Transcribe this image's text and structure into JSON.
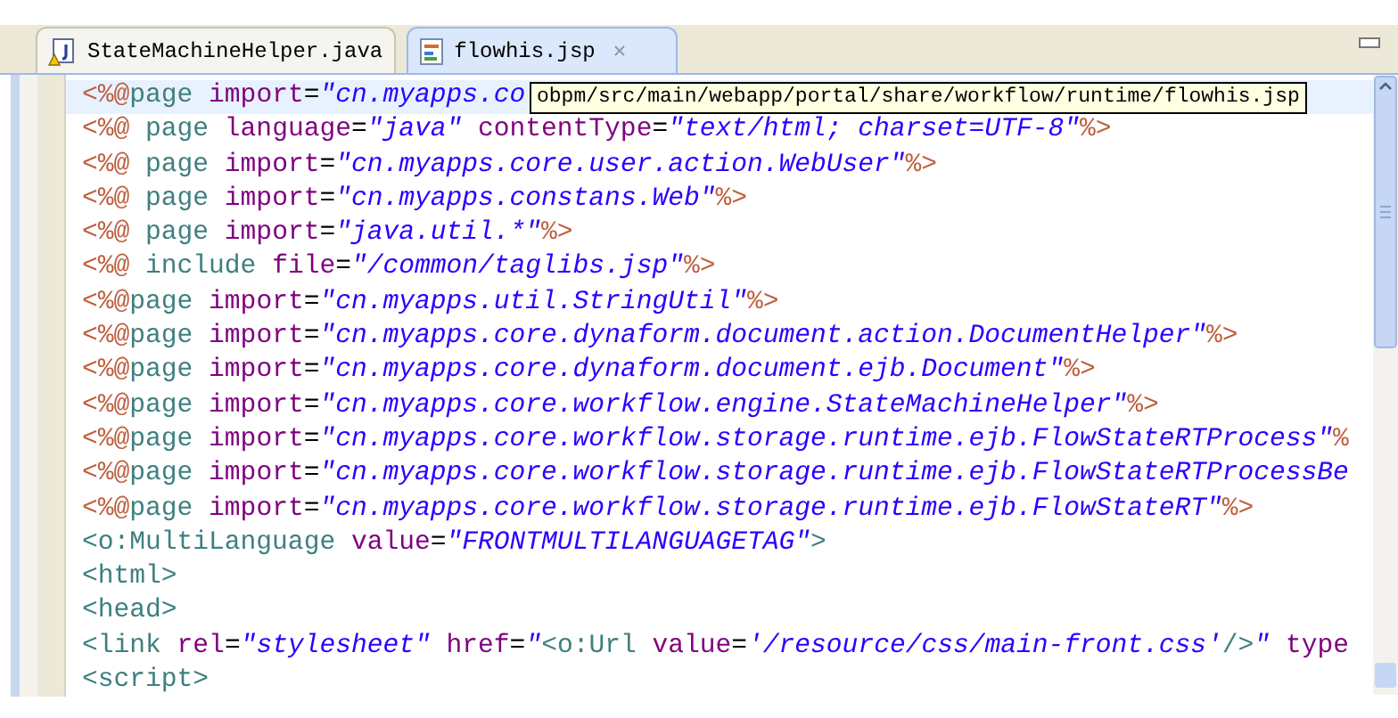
{
  "tabs": [
    {
      "label": "StateMachineHelper.java",
      "kind": "java",
      "selected": false
    },
    {
      "label": "flowhis.jsp",
      "kind": "jsp",
      "selected": true,
      "close": "✕"
    }
  ],
  "tooltip": "obpm/src/main/webapp/portal/share/workflow/runtime/flowhis.jsp",
  "editor": {
    "lines": [
      {
        "current": true,
        "tokens": [
          {
            "kind": "delim",
            "text": "<%@"
          },
          {
            "kind": "tag",
            "text": "page"
          },
          {
            "kind": "attr",
            "text": " import"
          },
          {
            "kind": "plain",
            "text": "="
          },
          {
            "kind": "string",
            "text": "\"cn.myapps.co"
          }
        ]
      },
      {
        "current": false,
        "tokens": [
          {
            "kind": "delim",
            "text": "<%@"
          },
          {
            "kind": "tag",
            "text": " page"
          },
          {
            "kind": "attr",
            "text": " language"
          },
          {
            "kind": "plain",
            "text": "="
          },
          {
            "kind": "string",
            "text": "\"java\""
          },
          {
            "kind": "attr",
            "text": " contentType"
          },
          {
            "kind": "plain",
            "text": "="
          },
          {
            "kind": "string",
            "text": "\"text/html; charset=UTF-8\""
          },
          {
            "kind": "delim",
            "text": "%>"
          }
        ]
      },
      {
        "current": false,
        "tokens": [
          {
            "kind": "delim",
            "text": "<%@"
          },
          {
            "kind": "tag",
            "text": " page"
          },
          {
            "kind": "attr",
            "text": " import"
          },
          {
            "kind": "plain",
            "text": "="
          },
          {
            "kind": "string",
            "text": "\"cn.myapps.core.user.action.WebUser\""
          },
          {
            "kind": "delim",
            "text": "%>"
          }
        ]
      },
      {
        "current": false,
        "tokens": [
          {
            "kind": "delim",
            "text": "<%@"
          },
          {
            "kind": "tag",
            "text": " page"
          },
          {
            "kind": "attr",
            "text": " import"
          },
          {
            "kind": "plain",
            "text": "="
          },
          {
            "kind": "string",
            "text": "\"cn.myapps.constans.Web\""
          },
          {
            "kind": "delim",
            "text": "%>"
          }
        ]
      },
      {
        "current": false,
        "tokens": [
          {
            "kind": "delim",
            "text": "<%@"
          },
          {
            "kind": "tag",
            "text": " page"
          },
          {
            "kind": "attr",
            "text": " import"
          },
          {
            "kind": "plain",
            "text": "="
          },
          {
            "kind": "string",
            "text": "\"java.util.*\""
          },
          {
            "kind": "delim",
            "text": "%>"
          }
        ]
      },
      {
        "current": false,
        "tokens": [
          {
            "kind": "delim",
            "text": "<%@"
          },
          {
            "kind": "tag",
            "text": " include"
          },
          {
            "kind": "attr",
            "text": " file"
          },
          {
            "kind": "plain",
            "text": "="
          },
          {
            "kind": "string",
            "text": "\"/common/taglibs.jsp\""
          },
          {
            "kind": "delim",
            "text": "%>"
          }
        ]
      },
      {
        "current": false,
        "tokens": [
          {
            "kind": "delim",
            "text": "<%@"
          },
          {
            "kind": "tag",
            "text": "page"
          },
          {
            "kind": "attr",
            "text": " import"
          },
          {
            "kind": "plain",
            "text": "="
          },
          {
            "kind": "string",
            "text": "\"cn.myapps.util.StringUtil\""
          },
          {
            "kind": "delim",
            "text": "%>"
          }
        ]
      },
      {
        "current": false,
        "tokens": [
          {
            "kind": "delim",
            "text": "<%@"
          },
          {
            "kind": "tag",
            "text": "page"
          },
          {
            "kind": "attr",
            "text": " import"
          },
          {
            "kind": "plain",
            "text": "="
          },
          {
            "kind": "string",
            "text": "\"cn.myapps.core.dynaform.document.action.DocumentHelper\""
          },
          {
            "kind": "delim",
            "text": "%>"
          }
        ]
      },
      {
        "current": false,
        "tokens": [
          {
            "kind": "delim",
            "text": "<%@"
          },
          {
            "kind": "tag",
            "text": "page"
          },
          {
            "kind": "attr",
            "text": " import"
          },
          {
            "kind": "plain",
            "text": "="
          },
          {
            "kind": "string",
            "text": "\"cn.myapps.core.dynaform.document.ejb.Document\""
          },
          {
            "kind": "delim",
            "text": "%>"
          }
        ]
      },
      {
        "current": false,
        "tokens": [
          {
            "kind": "delim",
            "text": "<%@"
          },
          {
            "kind": "tag",
            "text": "page"
          },
          {
            "kind": "attr",
            "text": " import"
          },
          {
            "kind": "plain",
            "text": "="
          },
          {
            "kind": "string",
            "text": "\"cn.myapps.core.workflow.engine.StateMachineHelper\""
          },
          {
            "kind": "delim",
            "text": "%>"
          }
        ]
      },
      {
        "current": false,
        "tokens": [
          {
            "kind": "delim",
            "text": "<%@"
          },
          {
            "kind": "tag",
            "text": "page"
          },
          {
            "kind": "attr",
            "text": " import"
          },
          {
            "kind": "plain",
            "text": "="
          },
          {
            "kind": "string",
            "text": "\"cn.myapps.core.workflow.storage.runtime.ejb.FlowStateRTProcess\""
          },
          {
            "kind": "delim",
            "text": "%"
          }
        ]
      },
      {
        "current": false,
        "tokens": [
          {
            "kind": "delim",
            "text": "<%@"
          },
          {
            "kind": "tag",
            "text": "page"
          },
          {
            "kind": "attr",
            "text": " import"
          },
          {
            "kind": "plain",
            "text": "="
          },
          {
            "kind": "string",
            "text": "\"cn.myapps.core.workflow.storage.runtime.ejb.FlowStateRTProcessBe"
          }
        ]
      },
      {
        "current": false,
        "tokens": [
          {
            "kind": "delim",
            "text": "<%@"
          },
          {
            "kind": "tag",
            "text": "page"
          },
          {
            "kind": "attr",
            "text": " import"
          },
          {
            "kind": "plain",
            "text": "="
          },
          {
            "kind": "string",
            "text": "\"cn.myapps.core.workflow.storage.runtime.ejb.FlowStateRT\""
          },
          {
            "kind": "delim",
            "text": "%>"
          }
        ]
      },
      {
        "current": false,
        "tokens": [
          {
            "kind": "tag",
            "text": "<o:MultiLanguage"
          },
          {
            "kind": "attr",
            "text": " value"
          },
          {
            "kind": "plain",
            "text": "="
          },
          {
            "kind": "string",
            "text": "\"FRONTMULTILANGUAGETAG\""
          },
          {
            "kind": "tag",
            "text": ">"
          }
        ]
      },
      {
        "current": false,
        "tokens": [
          {
            "kind": "tag",
            "text": "<html>"
          }
        ]
      },
      {
        "current": false,
        "tokens": [
          {
            "kind": "tag",
            "text": "<head>"
          }
        ]
      },
      {
        "current": false,
        "tokens": [
          {
            "kind": "tag",
            "text": "<link"
          },
          {
            "kind": "attr",
            "text": " rel"
          },
          {
            "kind": "plain",
            "text": "="
          },
          {
            "kind": "string",
            "text": "\"stylesheet\""
          },
          {
            "kind": "attr",
            "text": " href"
          },
          {
            "kind": "plain",
            "text": "="
          },
          {
            "kind": "string",
            "text": "\""
          },
          {
            "kind": "tag",
            "text": "<o:Url"
          },
          {
            "kind": "attr",
            "text": " value"
          },
          {
            "kind": "plain",
            "text": "="
          },
          {
            "kind": "string",
            "text": "'/resource/css/main-front.css'"
          },
          {
            "kind": "tag",
            "text": "/>"
          },
          {
            "kind": "string",
            "text": "\""
          },
          {
            "kind": "attr",
            "text": " type"
          }
        ]
      },
      {
        "current": false,
        "tokens": [
          {
            "kind": "tag",
            "text": "<script>"
          }
        ]
      }
    ]
  }
}
